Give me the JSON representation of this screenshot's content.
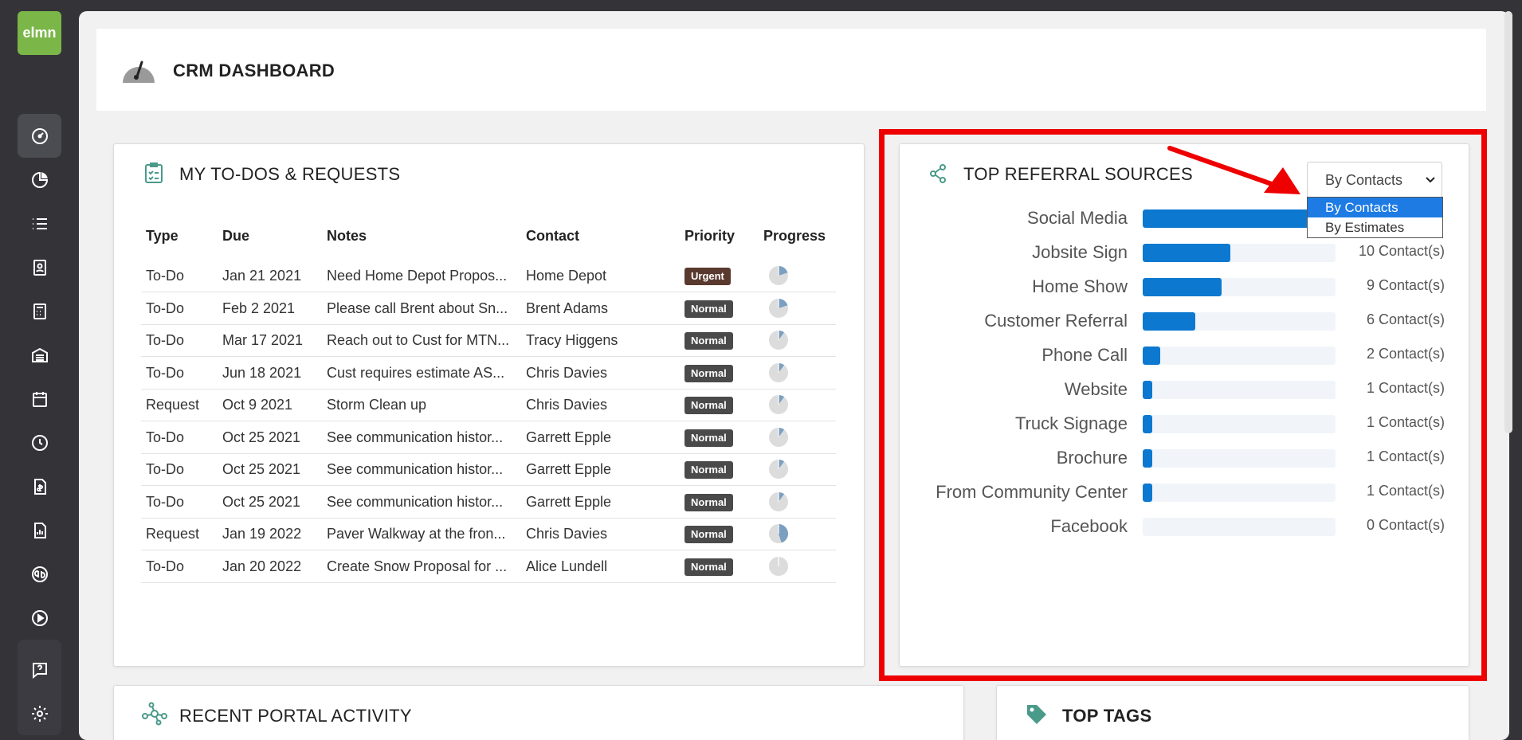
{
  "app": {
    "logo_text": "elmn",
    "accent": "#7ab648"
  },
  "sidebar": {
    "items": [
      {
        "name": "dashboard-icon",
        "active": true
      },
      {
        "name": "pie-chart-icon"
      },
      {
        "name": "list-icon"
      },
      {
        "name": "contact-card-icon"
      },
      {
        "name": "calculator-icon"
      },
      {
        "name": "warehouse-icon"
      },
      {
        "name": "calendar-icon"
      },
      {
        "name": "clock-icon"
      },
      {
        "name": "invoice-icon"
      },
      {
        "name": "report-icon"
      },
      {
        "name": "quickbooks-icon"
      },
      {
        "name": "play-icon"
      },
      {
        "name": "help-icon"
      },
      {
        "name": "settings-icon"
      }
    ]
  },
  "header": {
    "title": "CRM DASHBOARD"
  },
  "todos": {
    "title": "MY TO-DOS & REQUESTS",
    "columns": [
      "Type",
      "Due",
      "Notes",
      "Contact",
      "Priority",
      "Progress"
    ],
    "rows": [
      {
        "type": "To-Do",
        "due": "Jan 21 2021",
        "notes": "Need Home Depot Propos...",
        "contact": "Home Depot",
        "priority": "Urgent",
        "progress": 0.2
      },
      {
        "type": "To-Do",
        "due": "Feb 2 2021",
        "notes": "Please call Brent about Sn...",
        "contact": "Brent Adams",
        "priority": "Normal",
        "progress": 0.2
      },
      {
        "type": "To-Do",
        "due": "Mar 17 2021",
        "notes": "Reach out to Cust for MTN...",
        "contact": "Tracy Higgens",
        "priority": "Normal",
        "progress": 0.1
      },
      {
        "type": "To-Do",
        "due": "Jun 18 2021",
        "notes": "Cust requires estimate AS...",
        "contact": "Chris Davies",
        "priority": "Normal",
        "progress": 0.1
      },
      {
        "type": "Request",
        "due": "Oct 9 2021",
        "notes": "Storm Clean up",
        "contact": "Chris Davies",
        "priority": "Normal",
        "progress": 0.1
      },
      {
        "type": "To-Do",
        "due": "Oct 25 2021",
        "notes": "See communication histor...",
        "contact": "Garrett Epple",
        "priority": "Normal",
        "progress": 0.1
      },
      {
        "type": "To-Do",
        "due": "Oct 25 2021",
        "notes": "See communication histor...",
        "contact": "Garrett Epple",
        "priority": "Normal",
        "progress": 0.1
      },
      {
        "type": "To-Do",
        "due": "Oct 25 2021",
        "notes": "See communication histor...",
        "contact": "Garrett Epple",
        "priority": "Normal",
        "progress": 0.1
      },
      {
        "type": "Request",
        "due": "Jan 19 2022",
        "notes": "Paver Walkway at the fron...",
        "contact": "Chris Davies",
        "priority": "Normal",
        "progress": 0.45
      },
      {
        "type": "To-Do",
        "due": "Jan 20 2022",
        "notes": "Create Snow Proposal for ...",
        "contact": "Alice Lundell",
        "priority": "Normal",
        "progress": 0.0
      }
    ]
  },
  "referrals": {
    "title": "TOP REFERRAL SOURCES",
    "select_value": "By Contacts",
    "options": [
      "By Contacts",
      "By Estimates"
    ],
    "selected_option": "By Contacts",
    "bar_color": "#0c78d0",
    "highlight_color": "#ee0000"
  },
  "chart_data": {
    "type": "bar",
    "orientation": "horizontal",
    "categories": [
      "Social Media",
      "Jobsite Sign",
      "Home Show",
      "Customer Referral",
      "Phone Call",
      "Website",
      "Truck Signage",
      "Brochure",
      "From Community Center",
      "Facebook"
    ],
    "values": [
      null,
      10,
      9,
      6,
      2,
      1,
      1,
      1,
      1,
      0
    ],
    "value_labels": [
      "",
      "10 Contact(s)",
      "9 Contact(s)",
      "6 Contact(s)",
      "2 Contact(s)",
      "1 Contact(s)",
      "1 Contact(s)",
      "1 Contact(s)",
      "1 Contact(s)",
      "0 Contact(s)"
    ],
    "xlim": [
      0,
      22
    ]
  },
  "portal": {
    "title": "RECENT PORTAL ACTIVITY"
  },
  "tags": {
    "title": "TOP TAGS"
  }
}
